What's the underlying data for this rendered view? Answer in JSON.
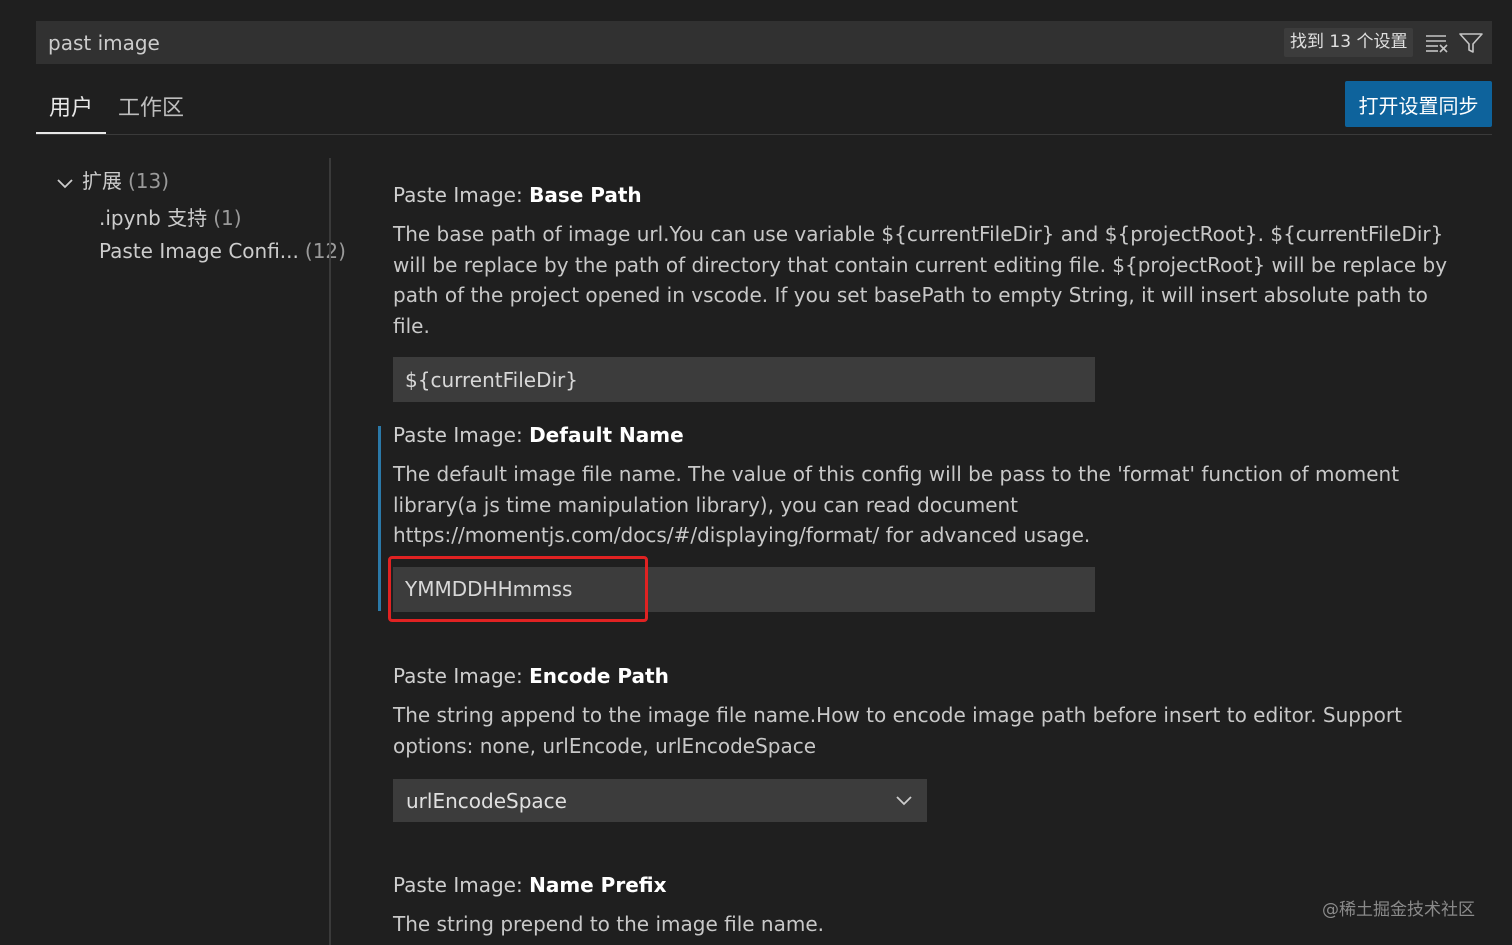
{
  "search": {
    "value": "past image",
    "result_count": "找到 13 个设置"
  },
  "tabs": [
    {
      "label": "用户",
      "active": true
    },
    {
      "label": "工作区",
      "active": false
    }
  ],
  "sync_button_label": "打开设置同步",
  "toc": {
    "group": {
      "label": "扩展",
      "count": "(13)"
    },
    "items": [
      {
        "label": ".ipynb 支持",
        "count": "(1)"
      },
      {
        "label": "Paste Image Confi...",
        "count": "(12)"
      }
    ]
  },
  "settings": [
    {
      "category": "Paste Image: ",
      "name": "Base Path",
      "description": "The base path of image url.You can use variable ${currentFileDir} and ${projectRoot}. ${currentFileDir} will be replace by the path of directory that contain current editing file. ${projectRoot} will be replace by path of the project opened in vscode. If you set basePath to empty String, it will insert absolute path to file.",
      "value": "${currentFileDir}"
    },
    {
      "category": "Paste Image: ",
      "name": "Default Name",
      "description": "The default image file name. The value of this config will be pass to the 'format' function of moment library(a js time manipulation library), you can read document https://momentjs.com/docs/#/displaying/format/ for advanced usage.",
      "value": "YMMDDHHmmss"
    },
    {
      "category": "Paste Image: ",
      "name": "Encode Path",
      "description": "The string append to the image file name.How to encode image path before insert to editor. Support options: none, urlEncode, urlEncodeSpace",
      "value": "urlEncodeSpace"
    },
    {
      "category": "Paste Image: ",
      "name": "Name Prefix",
      "description": "The string prepend to the image file name."
    }
  ],
  "watermark": "@稀土掘金技术社区",
  "colors": {
    "background": "#1f1f1f",
    "input_background": "#3c3c3c",
    "accent": "#0e639c",
    "focus_indicator": "#2b79a8",
    "highlight": "#e02222"
  }
}
